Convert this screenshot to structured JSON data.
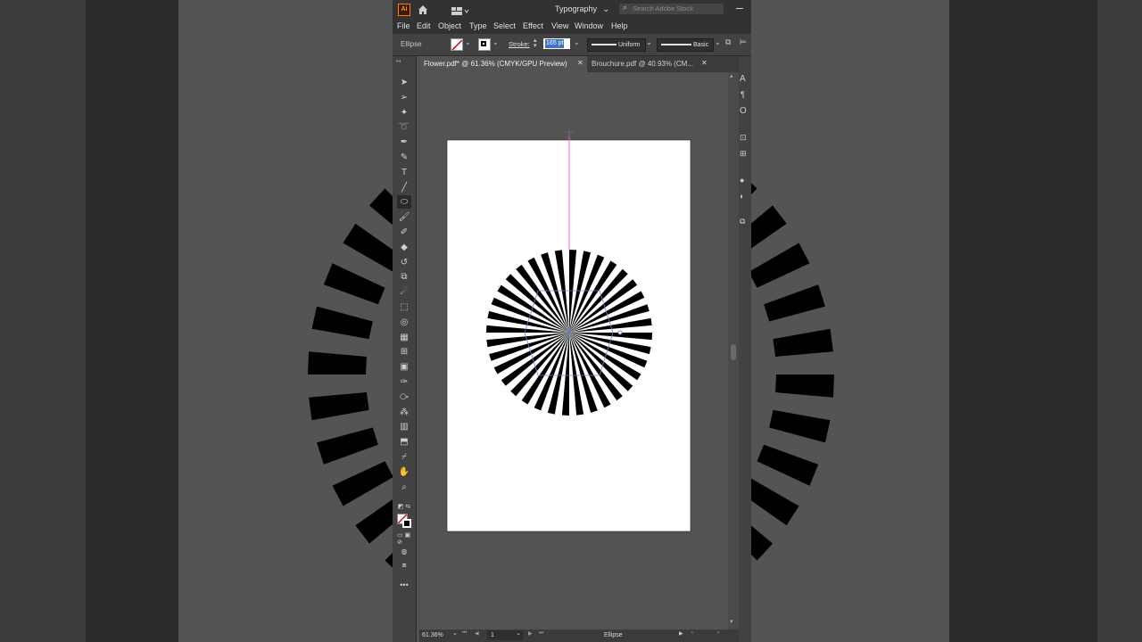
{
  "app": {
    "logo": "Ai",
    "workspace": "Typography",
    "search_placeholder": "Search Adobe Stock"
  },
  "menu": [
    "File",
    "Edit",
    "Object",
    "Type",
    "Select",
    "Effect",
    "View",
    "Window",
    "Help"
  ],
  "controlbar": {
    "object_type": "Ellipse",
    "stroke_label": "Stroke:",
    "stroke_value": "165 pt",
    "profile": "Uniform",
    "brush": "Basic"
  },
  "tabs": [
    {
      "label": "Flower.pdf* @ 61.36% (CMYK/GPU Preview)",
      "active": true
    },
    {
      "label": "Brouchure.pdf @ 40.93% (CM...",
      "active": false
    }
  ],
  "status": {
    "zoom": "61.36%",
    "artboard": "1",
    "selection": "Ellipse"
  },
  "artwork": {
    "stripe_count": 36,
    "colors": {
      "stripe": "#000000",
      "artboard": "#ffffff",
      "guide": "#e86ad8",
      "selection": "#5b7bd6"
    }
  },
  "toolbar": {
    "icons": [
      "selection-icon",
      "direct-selection-icon",
      "magic-wand-icon",
      "lasso-icon",
      "pen-icon",
      "curvature-icon",
      "type-icon",
      "line-segment-icon",
      "ellipse-icon",
      "paintbrush-icon",
      "shaper-icon",
      "eraser-icon",
      "rotate-icon",
      "scale-icon",
      "warp-icon",
      "free-transform-icon",
      "shape-builder-icon",
      "perspective-grid-icon",
      "mesh-icon",
      "gradient-icon",
      "eyedropper-icon",
      "blend-icon",
      "symbol-sprayer-icon",
      "column-graph-icon",
      "artboard-icon",
      "slice-icon",
      "hand-icon",
      "zoom-icon"
    ]
  }
}
